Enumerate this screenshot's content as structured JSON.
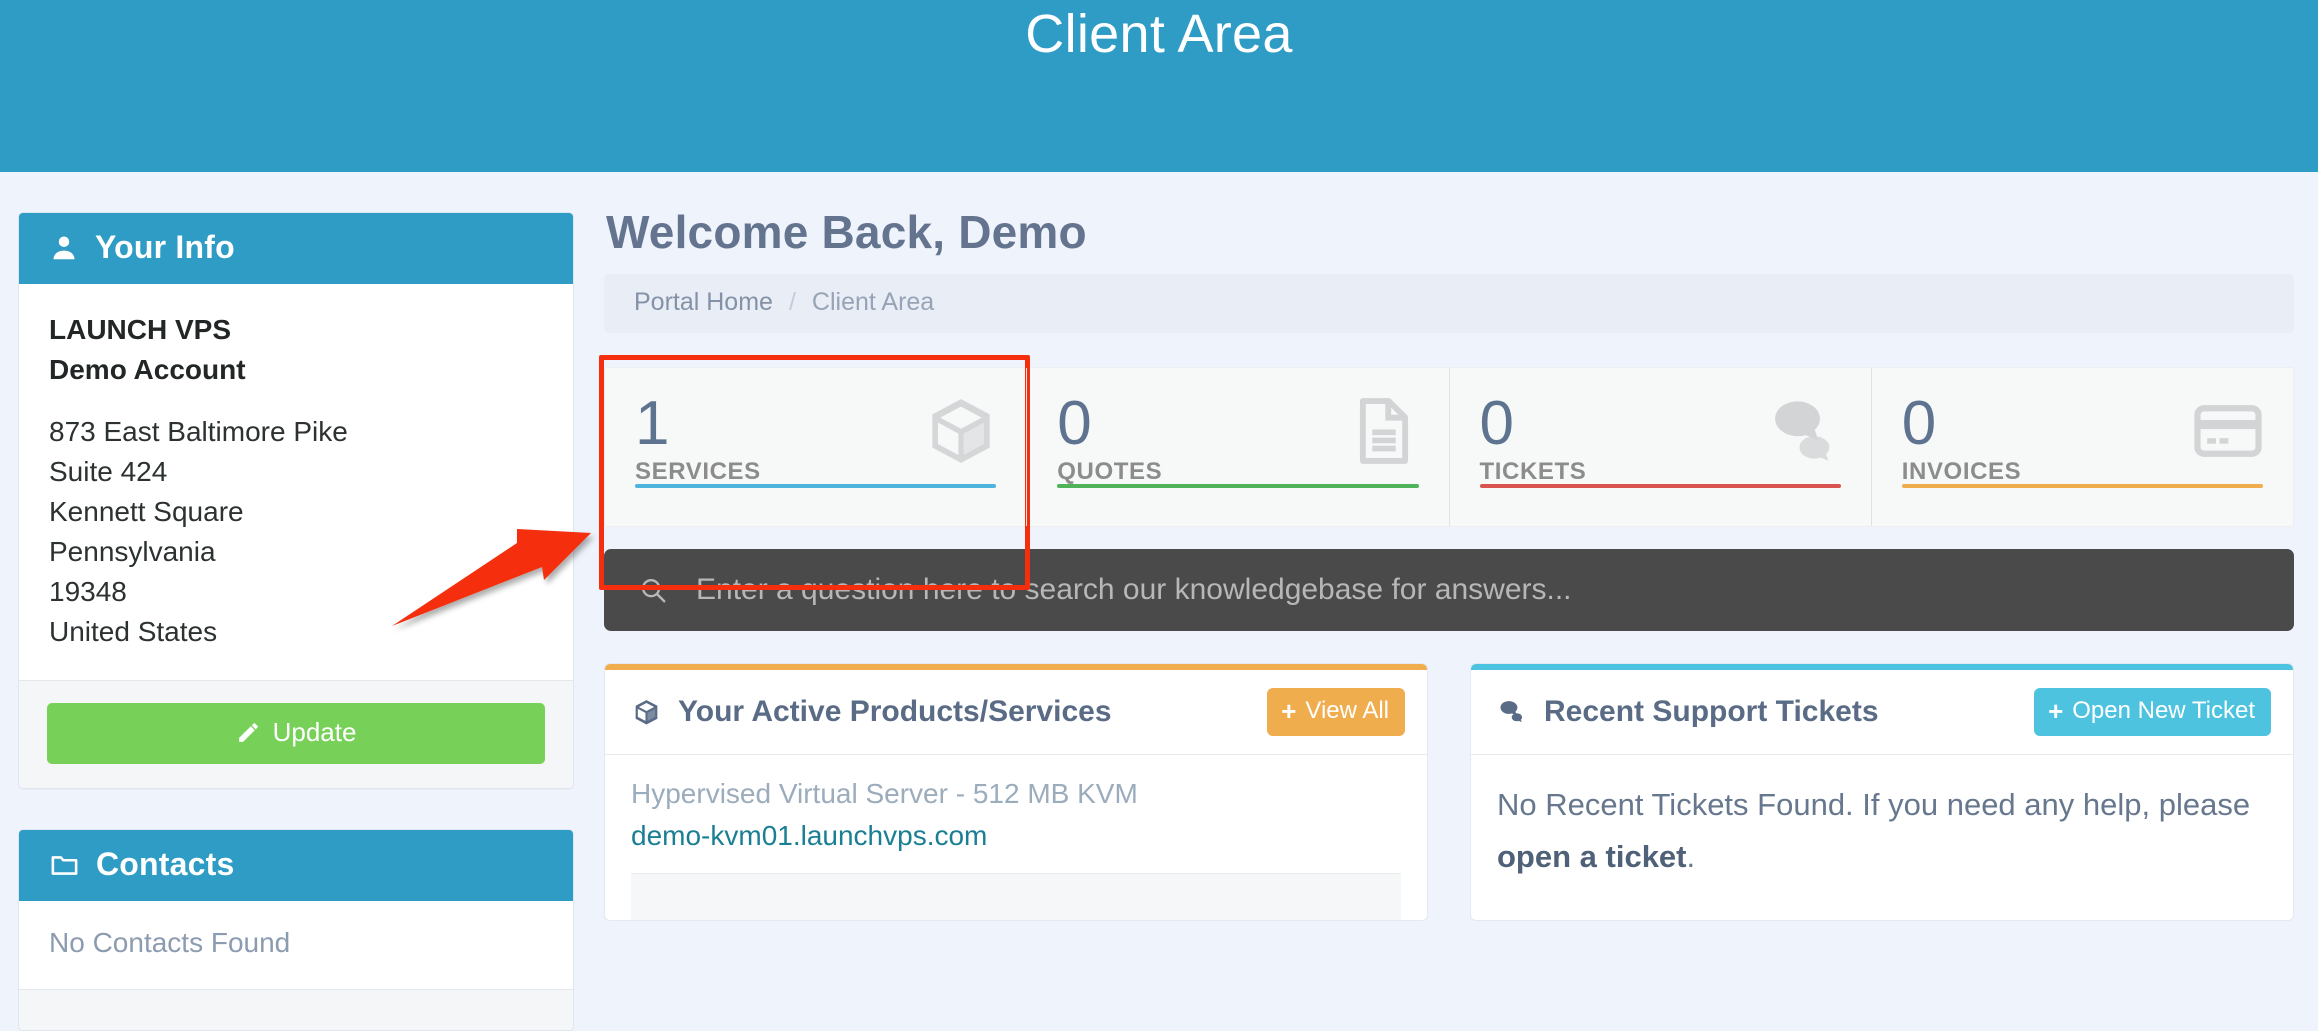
{
  "header": {
    "title": "Client Area"
  },
  "sidebar": {
    "your_info": {
      "heading": "Your Info",
      "icon": "user-icon",
      "account_line1": "LAUNCH VPS",
      "account_line2": "Demo Account",
      "address": [
        "873 East Baltimore Pike",
        "Suite 424",
        "Kennett Square",
        "Pennsylvania",
        "19348",
        "United States"
      ],
      "update_label": "Update",
      "update_icon": "pencil-icon"
    },
    "contacts": {
      "heading": "Contacts",
      "icon": "folder-icon",
      "empty_text": "No Contacts Found"
    }
  },
  "main": {
    "page_title": "Welcome Back, Demo",
    "breadcrumb": {
      "home": "Portal Home",
      "separator": "/",
      "current": "Client Area"
    },
    "stats": [
      {
        "value": "1",
        "label": "SERVICES",
        "rule_color": "#4eb3dd",
        "icon": "cube-icon",
        "highlighted": true
      },
      {
        "value": "0",
        "label": "QUOTES",
        "rule_color": "#4fb35a",
        "icon": "document-icon",
        "highlighted": false
      },
      {
        "value": "0",
        "label": "TICKETS",
        "rule_color": "#d9534f",
        "icon": "chat-bubbles-icon",
        "highlighted": false
      },
      {
        "value": "0",
        "label": "INVOICES",
        "rule_color": "#f0ad4e",
        "icon": "credit-card-icon",
        "highlighted": false
      }
    ],
    "search": {
      "placeholder": "Enter a question here to search our knowledgebase for answers...",
      "value": "",
      "icon": "search-icon"
    },
    "products_panel": {
      "title": "Your Active Products/Services",
      "icon": "cube-icon",
      "accent_color": "#f0ad4e",
      "view_all_label": "View All",
      "items": [
        {
          "name": "Hypervised Virtual Server - 512 MB KVM",
          "domain": "demo-kvm01.launchvps.com"
        }
      ]
    },
    "tickets_panel": {
      "title": "Recent Support Tickets",
      "icon": "chat-bubble-icon",
      "accent_color": "#4ec3e0",
      "open_ticket_label": "Open New Ticket",
      "empty_text_before": "No Recent Tickets Found. If you need any help, please ",
      "empty_link": "open a ticket",
      "empty_text_after": "."
    }
  },
  "annotation": {
    "arrow": "red-arrow-pointing-to-services-card",
    "box": "red-highlight-box-around-services-card",
    "color": "#f52f0d"
  }
}
